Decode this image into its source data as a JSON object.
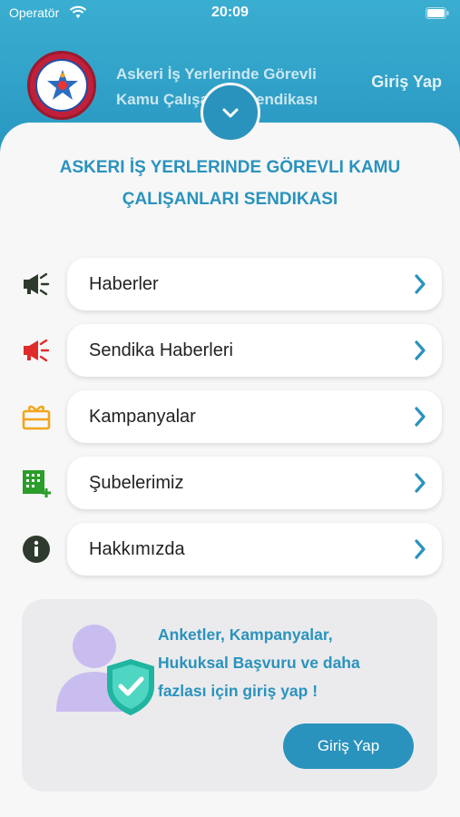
{
  "status_bar": {
    "carrier": "Operatör",
    "time": "20:09"
  },
  "header": {
    "title_line1": "Askeri İş Yerlerinde Görevli",
    "title_line2": "Kamu Çalışanları Sendikası",
    "login_label": "Giriş Yap",
    "logo_name": "logo-emblem"
  },
  "sheet": {
    "title_line1": "ASKERI İŞ YERLERINDE GÖREVLI KAMU",
    "title_line2": "ÇALIŞANLARI SENDIKASI"
  },
  "menu": [
    {
      "label": "Haberler",
      "icon": "megaphone-icon",
      "color": "#2d3a2d"
    },
    {
      "label": "Sendika Haberleri",
      "icon": "megaphone-icon",
      "color": "#e02b2b"
    },
    {
      "label": "Kampanyalar",
      "icon": "gift-icon",
      "color": "#f2a51a"
    },
    {
      "label": "Şubelerimiz",
      "icon": "building-add-icon",
      "color": "#2a9d2a"
    },
    {
      "label": "Hakkımızda",
      "icon": "info-icon",
      "color": "#2d3a2d"
    }
  ],
  "promo": {
    "text_line1": "Anketler, Kampanyalar,",
    "text_line2": "Hukuksal Başvuru ve daha",
    "text_line3": "fazlası için giriş yap !",
    "button_label": "Giriş Yap"
  },
  "colors": {
    "accent": "#2a93bd",
    "background": "#f7f7f8"
  }
}
